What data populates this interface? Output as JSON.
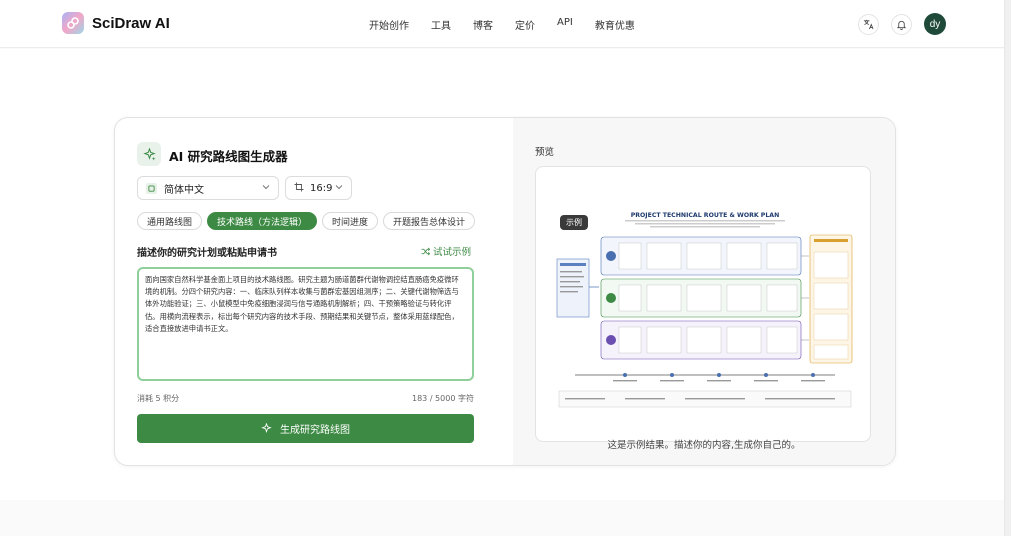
{
  "app": {
    "name": "SciDraw AI"
  },
  "nav": {
    "items": [
      "开始创作",
      "工具",
      "博客",
      "定价",
      "API",
      "教育优惠"
    ]
  },
  "user": {
    "initials": "dy"
  },
  "colors": {
    "accent": "#3d8a44",
    "avatar": "#1f4a3a"
  },
  "generator": {
    "title": "AI 研究路线图生成器",
    "language": {
      "selected": "简体中文"
    },
    "ratio": {
      "selected": "16:9"
    },
    "tabs": [
      {
        "label": "通用路线图",
        "active": false
      },
      {
        "label": "技术路线（方法逻辑）",
        "active": true
      },
      {
        "label": "时间进度",
        "active": false
      },
      {
        "label": "开题报告总体设计",
        "active": false
      }
    ],
    "prompt_label": "描述你的研究计划或粘贴申请书",
    "try_example": "试试示例",
    "input_value": "面向国家自然科学基金面上项目的技术路线图。研究主题为肠道菌群代谢物调控结直肠癌免疫微环境的机制。分四个研究内容：一、临床队列样本收集与菌群宏基因组测序；二、关键代谢物筛选与体外功能验证；三、小鼠模型中免疫细胞浸润与信号通路机制解析；四、干预策略验证与转化评估。用横向流程表示，标出每个研究内容的技术手段、预期结果和关键节点，整体采用蓝绿配色，适合直接放进申请书正文。",
    "cost": "消耗 5 积分",
    "char_count": "183 / 5000 字符",
    "generate_button": "生成研究路线图"
  },
  "preview": {
    "label": "预览",
    "badge": "示例",
    "caption": "这是示例结果。描述你的内容,生成你自己的。",
    "thumbnail_title": "PROJECT TECHNICAL ROUTE & WORK PLAN"
  }
}
